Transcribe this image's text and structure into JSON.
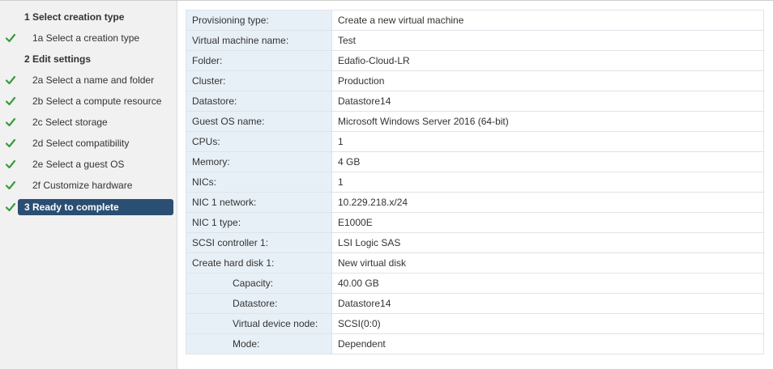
{
  "sidebar": {
    "steps": [
      {
        "label": "1  Select creation type",
        "type": "heading",
        "check": false,
        "active": false
      },
      {
        "label": "1a  Select a creation type",
        "type": "sub",
        "check": true,
        "active": false
      },
      {
        "label": "2  Edit settings",
        "type": "heading",
        "check": false,
        "active": false
      },
      {
        "label": "2a  Select a name and folder",
        "type": "sub",
        "check": true,
        "active": false
      },
      {
        "label": "2b  Select a compute resource",
        "type": "sub",
        "check": true,
        "active": false
      },
      {
        "label": "2c  Select storage",
        "type": "sub",
        "check": true,
        "active": false
      },
      {
        "label": "2d  Select compatibility",
        "type": "sub",
        "check": true,
        "active": false
      },
      {
        "label": "2e  Select a guest OS",
        "type": "sub",
        "check": true,
        "active": false
      },
      {
        "label": "2f  Customize hardware",
        "type": "sub",
        "check": true,
        "active": false
      },
      {
        "label": "3  Ready to complete",
        "type": "heading",
        "check": true,
        "active": true
      }
    ]
  },
  "details": {
    "rows": [
      {
        "label": "Provisioning type:",
        "value": "Create a new virtual machine",
        "indent": false
      },
      {
        "label": "Virtual machine name:",
        "value": "Test",
        "indent": false
      },
      {
        "label": "Folder:",
        "value": "Edafio-Cloud-LR",
        "indent": false
      },
      {
        "label": "Cluster:",
        "value": "Production",
        "indent": false
      },
      {
        "label": "Datastore:",
        "value": "Datastore14",
        "indent": false
      },
      {
        "label": "Guest OS name:",
        "value": "Microsoft Windows Server 2016 (64-bit)",
        "indent": false
      },
      {
        "label": "CPUs:",
        "value": "1",
        "indent": false
      },
      {
        "label": "Memory:",
        "value": "4 GB",
        "indent": false
      },
      {
        "label": "NICs:",
        "value": "1",
        "indent": false
      },
      {
        "label": "NIC 1 network:",
        "value": "10.229.218.x/24",
        "indent": false
      },
      {
        "label": "NIC 1 type:",
        "value": "E1000E",
        "indent": false
      },
      {
        "label": "SCSI controller 1:",
        "value": "LSI Logic SAS",
        "indent": false
      },
      {
        "label": "Create hard disk 1:",
        "value": "New virtual disk",
        "indent": false
      },
      {
        "label": "Capacity:",
        "value": "40.00 GB",
        "indent": true
      },
      {
        "label": "Datastore:",
        "value": "Datastore14",
        "indent": true
      },
      {
        "label": "Virtual device node:",
        "value": "SCSI(0:0)",
        "indent": true
      },
      {
        "label": "Mode:",
        "value": "Dependent",
        "indent": true
      }
    ]
  },
  "colors": {
    "check": "#3c9a3c",
    "active_step_bg": "#2b4e73",
    "label_cell_bg": "#e8f0f7"
  }
}
